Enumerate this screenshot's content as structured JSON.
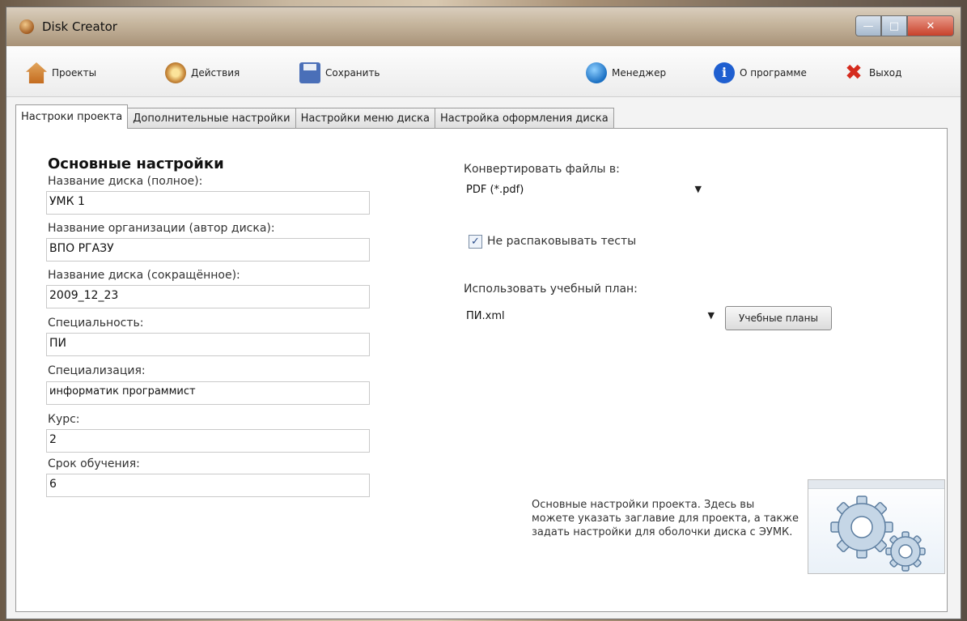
{
  "window": {
    "title": "Disk Creator"
  },
  "toolbar": {
    "projects": "Проекты",
    "actions": "Действия",
    "save": "Сохранить",
    "manager": "Менеджер",
    "about": "О программе",
    "exit": "Выход"
  },
  "tabs": [
    {
      "label": "Настроки проекта",
      "active": true
    },
    {
      "label": "Дополнительные настройки"
    },
    {
      "label": "Настройки меню диска"
    },
    {
      "label": "Настройка оформления диска"
    }
  ],
  "main": {
    "section_title": "Основные настройки",
    "fields": [
      {
        "label": "Название  диска (полное):",
        "value": "УМК 1"
      },
      {
        "label": "Название  организации (автор диска):",
        "value": "ВПО РГАЗУ"
      },
      {
        "label": "Название диска (сокращённое):",
        "value": "2009_12_23"
      },
      {
        "label": "Специальность:",
        "value": "ПИ"
      },
      {
        "label": "Специализация:",
        "value": "информатик программист"
      },
      {
        "label": "Курс:",
        "value": "2"
      },
      {
        "label": "Срок обучения:",
        "value": "6"
      }
    ]
  },
  "right": {
    "convert_label": "Конвертировать файлы в:",
    "convert_value": "PDF (*.pdf)",
    "no_unpack_label": "Не распаковывать тесты",
    "no_unpack_checked": true,
    "plan_label": "Использовать учебный план:",
    "plan_value": "ПИ.xml",
    "plans_button": "Учебные планы"
  },
  "help": {
    "text": "Основные настройки проекта. Здесь вы можете указать заглавие для проекта, а также задать настройки для оболочки диска с ЭУМК.",
    "icon": "gears-icon"
  }
}
